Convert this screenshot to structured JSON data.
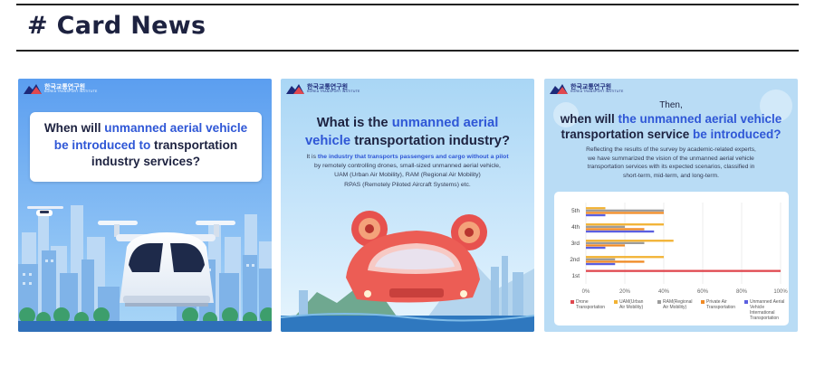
{
  "section": {
    "title": "# Card News"
  },
  "logo": {
    "korean": "한국교통연구원",
    "english": "KOREA TRANSPORT INSTITUTE"
  },
  "cards": [
    {
      "question_lines": [
        [
          {
            "text": "When will ",
            "hl": false
          },
          {
            "text": "unmanned aerial vehicle",
            "hl": true
          }
        ],
        [
          {
            "text": "be introduced to",
            "hl": true
          },
          {
            "text": " transportation",
            "hl": false
          }
        ],
        [
          {
            "text": "industry services?",
            "hl": false
          }
        ]
      ]
    },
    {
      "headline_lines": [
        [
          {
            "text": "What is the ",
            "hl": false
          },
          {
            "text": "unmanned aerial",
            "hl": true
          }
        ],
        [
          {
            "text": "vehicle",
            "hl": true
          },
          {
            "text": " transportation industry?",
            "hl": false
          }
        ]
      ],
      "body_lines": [
        [
          {
            "text": "It is ",
            "hl": false
          },
          {
            "text": "the industry that transports passengers and cargo without a pilot",
            "hl": true
          }
        ],
        [
          {
            "text": "by remotely controlling drones, small-sized unmanned aerial vehicle,",
            "hl": false
          }
        ],
        [
          {
            "text": "UAM (Urban Air Mobility), RAM (Regional Air Mobility)",
            "hl": false
          }
        ],
        [
          {
            "text": "RPAS (Remotely Piloted Aircraft Systems) etc.",
            "hl": false
          }
        ]
      ]
    },
    {
      "intro": "Then,",
      "headline_lines": [
        [
          {
            "text": "when will ",
            "hl": false
          },
          {
            "text": "the unmanned aerial vehicle",
            "hl": true
          }
        ],
        [
          {
            "text": "transportation service ",
            "hl": false
          },
          {
            "text": "be introduced?",
            "hl": true
          }
        ]
      ],
      "body_lines": [
        [
          {
            "text": "Reflecting the results of the survey by academic-related experts,",
            "hl": false
          }
        ],
        [
          {
            "text": "we have summarized the vision of the unmanned aerial vehicle",
            "hl": false
          }
        ],
        [
          {
            "text": "transportation services with its expected scenarios, classified in",
            "hl": false
          }
        ],
        [
          {
            "text": "short-term, mid-term, and long-term.",
            "hl": false
          }
        ]
      ]
    }
  ],
  "chart_data": {
    "type": "bar",
    "orientation": "horizontal",
    "categories": [
      "5th",
      "4th",
      "3rd",
      "2nd",
      "1st"
    ],
    "x_ticks": [
      "0%",
      "20%",
      "40%",
      "60%",
      "80%",
      "100%"
    ],
    "xlim": [
      0,
      100
    ],
    "grid": true,
    "legend_position": "bottom",
    "series": [
      {
        "name": "Drone Transportation",
        "color": "#e0484f",
        "values": [
          0,
          0,
          0,
          0,
          100
        ]
      },
      {
        "name": "UAM(Urban Air Mobility)",
        "color": "#f2b233",
        "values": [
          10,
          40,
          45,
          40,
          0
        ]
      },
      {
        "name": "RAM(Regional Air Mobility)",
        "color": "#9c9c9c",
        "values": [
          40,
          20,
          30,
          15,
          0
        ]
      },
      {
        "name": "Private Air Transportation",
        "color": "#f08a24",
        "values": [
          40,
          30,
          20,
          30,
          0
        ]
      },
      {
        "name": "Unmanned Aerial Vehicle International Transportation",
        "color": "#5b5fe0",
        "values": [
          10,
          35,
          10,
          15,
          0
        ]
      }
    ],
    "legend_lines": [
      [
        "Drone",
        "Transportation"
      ],
      [
        "UAM(Urban",
        "Air Mobility)"
      ],
      [
        "RAM(Regional",
        "Air Mobility)"
      ],
      [
        "Private Air",
        "Transportation"
      ],
      [
        "Unmanned Aerial",
        "Vehicle International",
        "Transportation"
      ]
    ]
  }
}
